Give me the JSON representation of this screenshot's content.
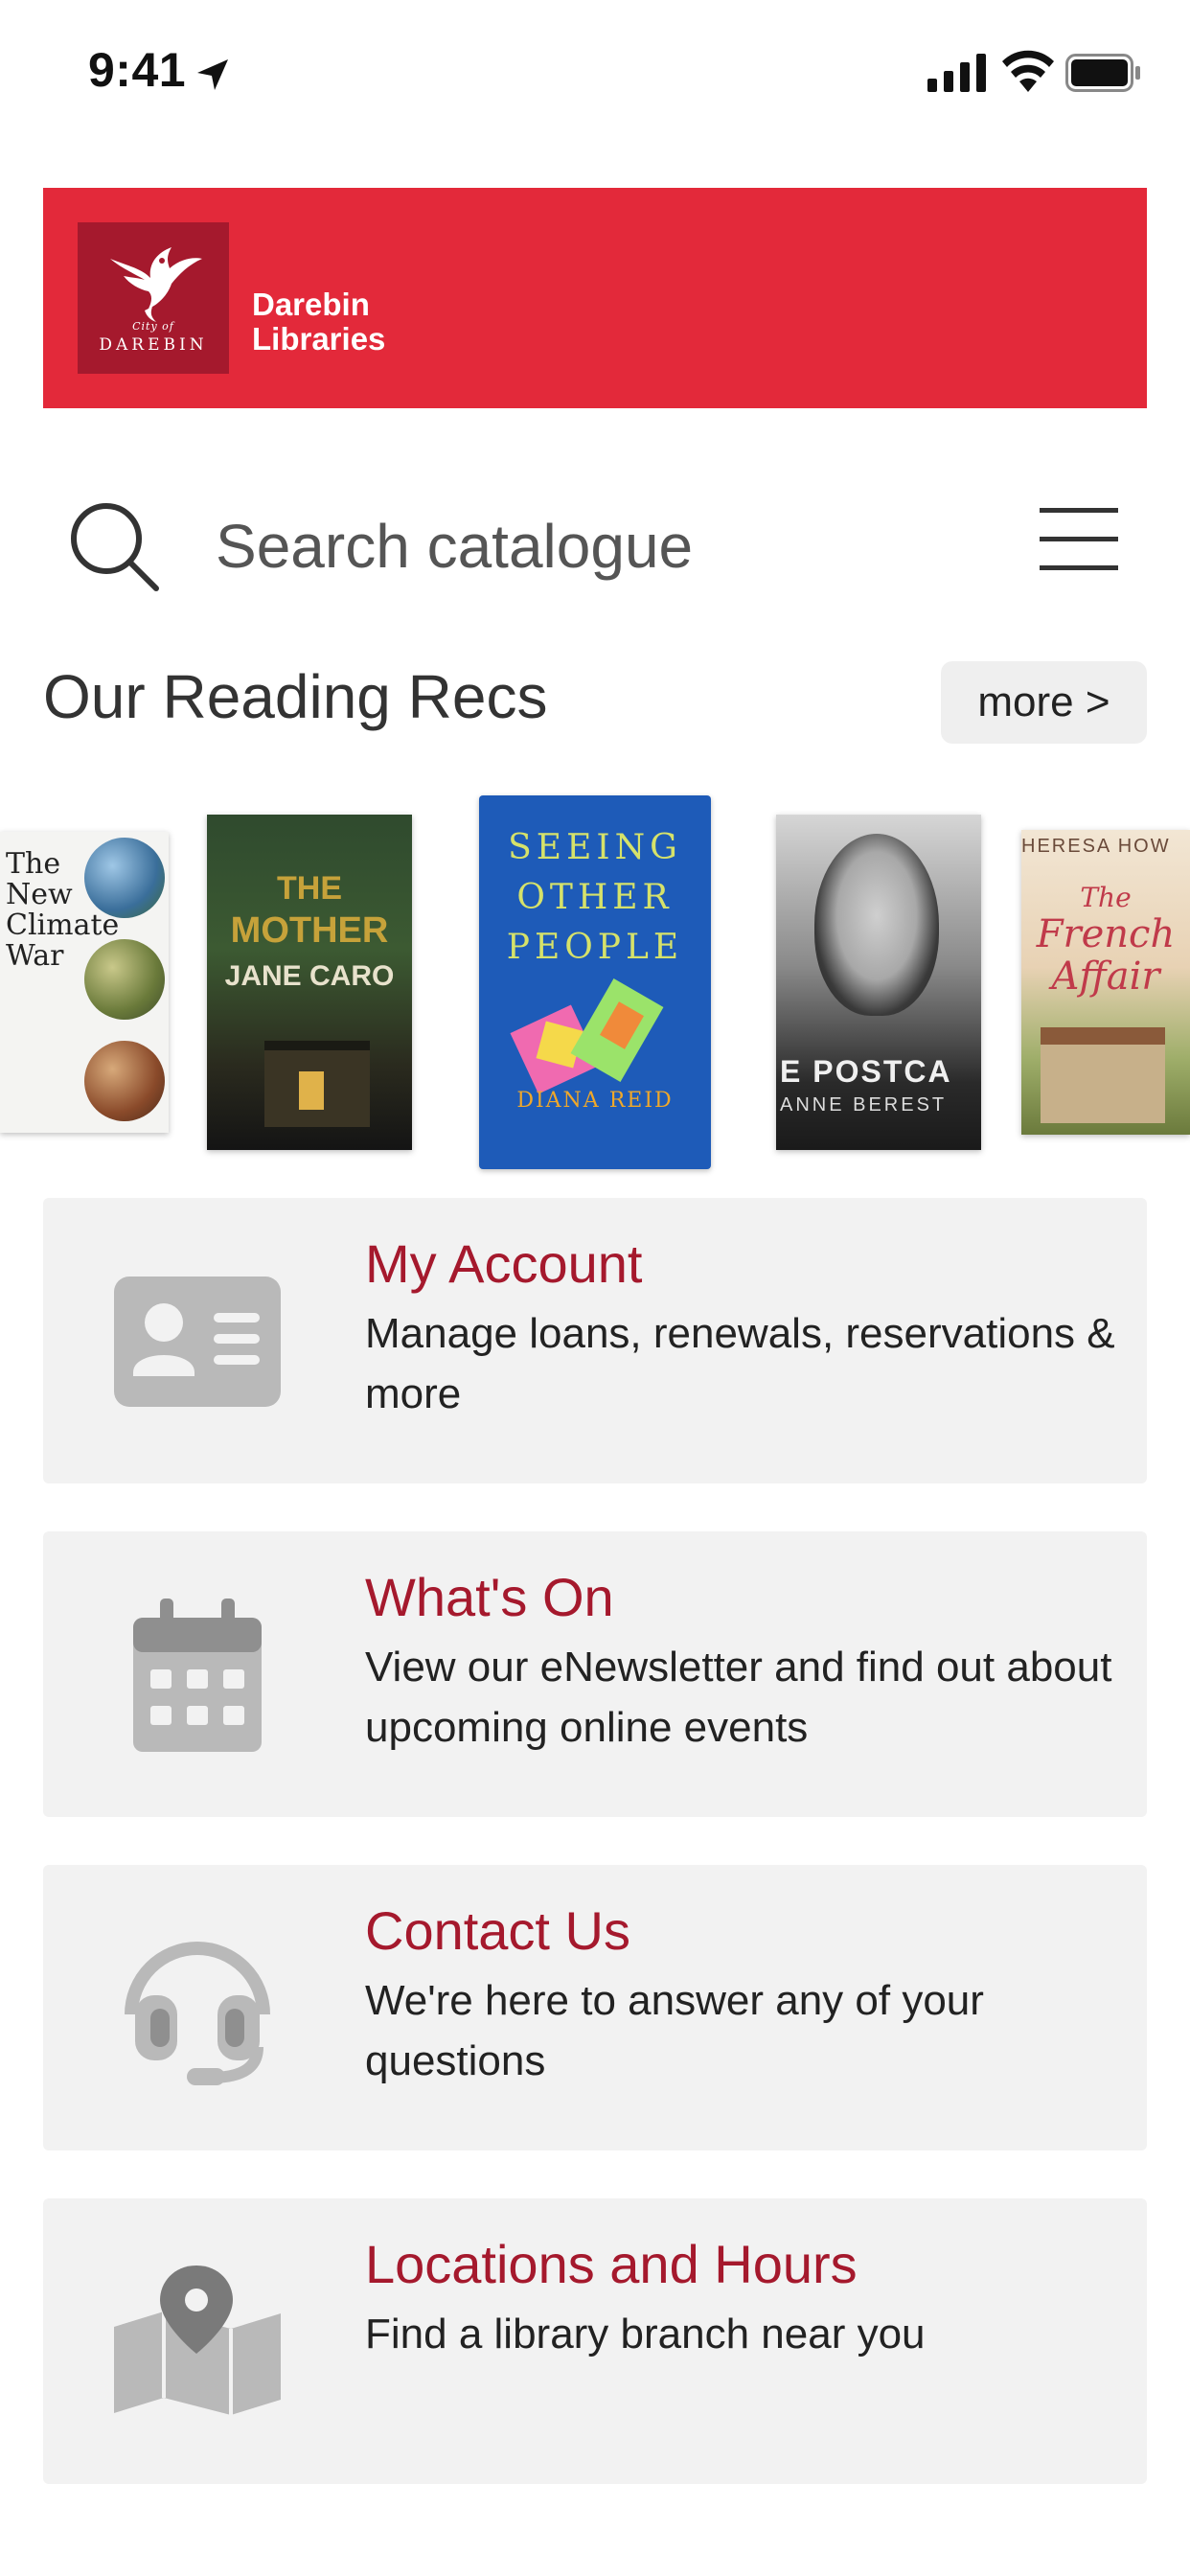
{
  "status_bar": {
    "time": "9:41"
  },
  "header": {
    "logo_city_of": "City of",
    "logo_name": "DAREBIN",
    "title_line1": "Darebin",
    "title_line2": "Libraries",
    "brand_color": "#e3293a",
    "logo_color": "#a5192d"
  },
  "search": {
    "placeholder": "Search catalogue"
  },
  "recs": {
    "title": "Our Reading Recs",
    "more_label": "more >",
    "books": [
      {
        "cover_text": [
          "The",
          "New",
          "Climate",
          "War"
        ]
      },
      {
        "cover_text": [
          "THE",
          "MOTHER",
          "JANE CARO"
        ]
      },
      {
        "cover_text": [
          "SEEING",
          "OTHER",
          "PEOPLE",
          "DIANA REID"
        ]
      },
      {
        "cover_text": [
          "E POSTCA",
          "ANNE BEREST"
        ]
      },
      {
        "cover_text": [
          "HERESA HOW",
          "The",
          "French",
          "Affair"
        ]
      }
    ]
  },
  "cards": [
    {
      "title": "My Account",
      "description": "Manage loans, renewals, reservations & more",
      "icon": "id-card-icon"
    },
    {
      "title": "What's On",
      "description": "View our eNewsletter and find out about upcoming online events",
      "icon": "calendar-icon"
    },
    {
      "title": "Contact Us",
      "description": "We're here to answer any of your questions",
      "icon": "headset-icon"
    },
    {
      "title": "Locations and Hours",
      "description": "Find a library branch near you",
      "icon": "map-pin-icon"
    }
  ],
  "colors": {
    "accent_text": "#a5192d",
    "card_background": "#f2f2f2",
    "icon_gray": "#b9b9b9"
  }
}
